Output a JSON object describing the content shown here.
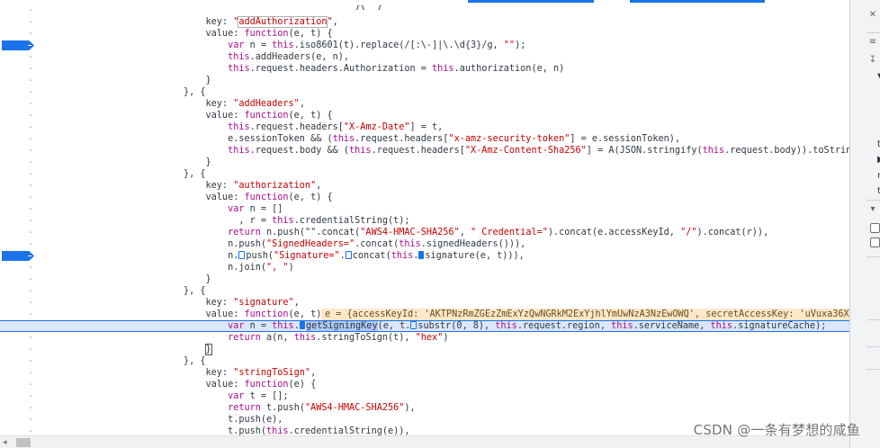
{
  "editor": {
    "lines": [
      {
        "indent": 0,
        "gutter": "-",
        "breakpoint": false,
        "paused": false,
        "parts": [
          {
            "t": "                                {}, {"
          }
        ],
        "hidden_prefix": true
      },
      {
        "indent": 0,
        "gutter": "-",
        "breakpoint": false,
        "paused": false,
        "parts": [
          {
            "t": "    key: ",
            "c": "tk"
          },
          {
            "t": "\"",
            "c": "str"
          },
          {
            "t": "addAuthorization",
            "c": "str boxed"
          },
          {
            "t": "\"",
            "c": "str"
          },
          {
            "t": ","
          }
        ]
      },
      {
        "indent": 0,
        "gutter": "-",
        "breakpoint": false,
        "paused": false,
        "parts": [
          {
            "t": "    value: "
          },
          {
            "t": "function",
            "c": "kw"
          },
          {
            "t": "(e, t) {"
          }
        ]
      },
      {
        "indent": 0,
        "gutter": "-",
        "breakpoint": true,
        "paused": false,
        "parts": [
          {
            "t": "        "
          },
          {
            "t": "var",
            "c": "kw"
          },
          {
            "t": " n = "
          },
          {
            "t": "this",
            "c": "kw"
          },
          {
            "t": ".iso8601(t).replace(/[:\\-]|\\.\\d{3}/g, "
          },
          {
            "t": "\"\"",
            "c": "str"
          },
          {
            "t": ");"
          }
        ]
      },
      {
        "indent": 0,
        "gutter": "-",
        "breakpoint": false,
        "paused": false,
        "parts": [
          {
            "t": "        "
          },
          {
            "t": "this",
            "c": "kw"
          },
          {
            "t": ".addHeaders(e, n),"
          }
        ]
      },
      {
        "indent": 0,
        "gutter": "-",
        "breakpoint": false,
        "paused": false,
        "parts": [
          {
            "t": "        "
          },
          {
            "t": "this",
            "c": "kw"
          },
          {
            "t": ".request.headers.Authorization = "
          },
          {
            "t": "this",
            "c": "kw"
          },
          {
            "t": ".authorization(e, n)"
          }
        ]
      },
      {
        "indent": 0,
        "gutter": "-",
        "breakpoint": false,
        "paused": false,
        "parts": [
          {
            "t": "    }"
          }
        ]
      },
      {
        "indent": 0,
        "gutter": "-",
        "breakpoint": false,
        "paused": false,
        "parts": [
          {
            "t": "}, {"
          }
        ]
      },
      {
        "indent": 0,
        "gutter": "-",
        "breakpoint": false,
        "paused": false,
        "parts": [
          {
            "t": "    key: "
          },
          {
            "t": "\"addHeaders\"",
            "c": "str"
          },
          {
            "t": ","
          }
        ]
      },
      {
        "indent": 0,
        "gutter": "-",
        "breakpoint": false,
        "paused": false,
        "parts": [
          {
            "t": "    value: "
          },
          {
            "t": "function",
            "c": "kw"
          },
          {
            "t": "(e, t) {"
          }
        ]
      },
      {
        "indent": 0,
        "gutter": "-",
        "breakpoint": false,
        "paused": false,
        "parts": [
          {
            "t": "        "
          },
          {
            "t": "this",
            "c": "kw"
          },
          {
            "t": ".request.headers["
          },
          {
            "t": "\"X-Amz-Date\"",
            "c": "str"
          },
          {
            "t": "] = t,"
          }
        ]
      },
      {
        "indent": 0,
        "gutter": "-",
        "breakpoint": false,
        "paused": false,
        "parts": [
          {
            "t": "        e.sessionToken && ("
          },
          {
            "t": "this",
            "c": "kw"
          },
          {
            "t": ".request.headers["
          },
          {
            "t": "\"x-amz-security-token\"",
            "c": "str"
          },
          {
            "t": "] = e.sessionToken),"
          }
        ]
      },
      {
        "indent": 0,
        "gutter": "-",
        "breakpoint": false,
        "paused": false,
        "parts": [
          {
            "t": "        "
          },
          {
            "t": "this",
            "c": "kw"
          },
          {
            "t": ".request.body && ("
          },
          {
            "t": "this",
            "c": "kw"
          },
          {
            "t": ".request.headers["
          },
          {
            "t": "\"X-Amz-Content-Sha256\"",
            "c": "str"
          },
          {
            "t": "] = A(JSON.stringify("
          },
          {
            "t": "this",
            "c": "kw"
          },
          {
            "t": ".request.body)).toString())"
          }
        ]
      },
      {
        "indent": 0,
        "gutter": "-",
        "breakpoint": false,
        "paused": false,
        "parts": [
          {
            "t": "    }"
          }
        ]
      },
      {
        "indent": 0,
        "gutter": "-",
        "breakpoint": false,
        "paused": false,
        "parts": [
          {
            "t": "}, {"
          }
        ]
      },
      {
        "indent": 0,
        "gutter": "-",
        "breakpoint": false,
        "paused": false,
        "parts": [
          {
            "t": "    key: "
          },
          {
            "t": "\"authorization\"",
            "c": "str"
          },
          {
            "t": ","
          }
        ]
      },
      {
        "indent": 0,
        "gutter": "-",
        "breakpoint": false,
        "paused": false,
        "parts": [
          {
            "t": "    value: "
          },
          {
            "t": "function",
            "c": "kw"
          },
          {
            "t": "(e, t) {"
          }
        ]
      },
      {
        "indent": 0,
        "gutter": "-",
        "breakpoint": false,
        "paused": false,
        "parts": [
          {
            "t": "        "
          },
          {
            "t": "var",
            "c": "kw"
          },
          {
            "t": " n = []"
          }
        ]
      },
      {
        "indent": 0,
        "gutter": "-",
        "breakpoint": false,
        "paused": false,
        "parts": [
          {
            "t": "          , r = "
          },
          {
            "t": "this",
            "c": "kw"
          },
          {
            "t": ".credentialString(t);"
          }
        ]
      },
      {
        "indent": 0,
        "gutter": "-",
        "breakpoint": false,
        "paused": false,
        "parts": [
          {
            "t": "        "
          },
          {
            "t": "return",
            "c": "kw"
          },
          {
            "t": " n.push(\"\".concat("
          },
          {
            "t": "\"AWS4-HMAC-SHA256\"",
            "c": "str"
          },
          {
            "t": ", "
          },
          {
            "t": "\" Credential=\"",
            "c": "str"
          },
          {
            "t": ").concat(e.accessKeyId, "
          },
          {
            "t": "\"/\"",
            "c": "str"
          },
          {
            "t": ").concat(r)),"
          }
        ]
      },
      {
        "indent": 0,
        "gutter": "-",
        "breakpoint": false,
        "paused": false,
        "parts": [
          {
            "t": "        n.push("
          },
          {
            "t": "\"SignedHeaders=\"",
            "c": "str"
          },
          {
            "t": ".concat("
          },
          {
            "t": "this",
            "c": "kw"
          },
          {
            "t": ".signedHeaders())),"
          }
        ]
      },
      {
        "indent": 0,
        "gutter": "-",
        "breakpoint": true,
        "paused": false,
        "parts": [
          {
            "t": "        n."
          },
          {
            "t": "",
            "c": "step outline"
          },
          {
            "t": "push("
          },
          {
            "t": "\"Signature=\"",
            "c": "str"
          },
          {
            "t": "."
          },
          {
            "t": "",
            "c": "step outline"
          },
          {
            "t": "concat("
          },
          {
            "t": "this",
            "c": "kw"
          },
          {
            "t": "."
          },
          {
            "t": "",
            "c": "step"
          },
          {
            "t": "signature(e, t))),"
          }
        ]
      },
      {
        "indent": 0,
        "gutter": "-",
        "breakpoint": false,
        "paused": false,
        "parts": [
          {
            "t": "        n.join("
          },
          {
            "t": "\", \"",
            "c": "str"
          },
          {
            "t": ")"
          }
        ]
      },
      {
        "indent": 0,
        "gutter": "-",
        "breakpoint": false,
        "paused": false,
        "parts": [
          {
            "t": "    }"
          }
        ]
      },
      {
        "indent": 0,
        "gutter": "-",
        "breakpoint": false,
        "paused": false,
        "parts": [
          {
            "t": "}, {"
          }
        ]
      },
      {
        "indent": 0,
        "gutter": "-",
        "breakpoint": false,
        "paused": false,
        "parts": [
          {
            "t": "    key: "
          },
          {
            "t": "\"signature\"",
            "c": "str"
          },
          {
            "t": ","
          }
        ]
      },
      {
        "indent": 0,
        "gutter": "-",
        "breakpoint": false,
        "paused": false,
        "parts": [
          {
            "t": "    value: "
          },
          {
            "t": "function",
            "c": "kw"
          },
          {
            "t": "(e, t) {"
          }
        ],
        "inline_value": "e = {accessKeyId: 'AKTPNzRmZGEzZmExYzQwNGRkM2ExYjhlYmUwNzA3NzEwOWQ', secretAccessKey: 'uVuxa36Xe"
      },
      {
        "indent": 0,
        "gutter": "-",
        "breakpoint": true,
        "paused": true,
        "parts": [
          {
            "t": "        "
          },
          {
            "t": "var",
            "c": "kw"
          },
          {
            "t": " n = "
          },
          {
            "t": "this",
            "c": "kw"
          },
          {
            "t": "."
          },
          {
            "t": "",
            "c": "step"
          },
          {
            "t": "getSigningKey",
            "c": "hl"
          },
          {
            "t": "(e, t."
          },
          {
            "t": "",
            "c": "step outline"
          },
          {
            "t": "substr(0, 8), "
          },
          {
            "t": "this",
            "c": "kw"
          },
          {
            "t": ".request.region, "
          },
          {
            "t": "this",
            "c": "kw"
          },
          {
            "t": ".serviceName, "
          },
          {
            "t": "this",
            "c": "kw"
          },
          {
            "t": ".signatureCache);"
          }
        ]
      },
      {
        "indent": 0,
        "gutter": "-",
        "breakpoint": false,
        "paused": false,
        "parts": [
          {
            "t": "        "
          },
          {
            "t": "return",
            "c": "kw"
          },
          {
            "t": " a(n, "
          },
          {
            "t": "this",
            "c": "kw"
          },
          {
            "t": ".stringToSign(t), "
          },
          {
            "t": "\"hex\"",
            "c": "str"
          },
          {
            "t": ")"
          }
        ]
      },
      {
        "indent": 0,
        "gutter": "-",
        "breakpoint": false,
        "paused": false,
        "parts": [
          {
            "t": "    "
          },
          {
            "t": "}",
            "c": "cursor-box"
          }
        ]
      },
      {
        "indent": 0,
        "gutter": "-",
        "breakpoint": false,
        "paused": false,
        "parts": [
          {
            "t": "}, {"
          }
        ]
      },
      {
        "indent": 0,
        "gutter": "-",
        "breakpoint": false,
        "paused": false,
        "parts": [
          {
            "t": "    key: "
          },
          {
            "t": "\"stringToSign\"",
            "c": "str"
          },
          {
            "t": ","
          }
        ]
      },
      {
        "indent": 0,
        "gutter": "-",
        "breakpoint": false,
        "paused": false,
        "parts": [
          {
            "t": "    value: "
          },
          {
            "t": "function",
            "c": "kw"
          },
          {
            "t": "(e) {"
          }
        ]
      },
      {
        "indent": 0,
        "gutter": "-",
        "breakpoint": false,
        "paused": false,
        "parts": [
          {
            "t": "        "
          },
          {
            "t": "var",
            "c": "kw"
          },
          {
            "t": " t = [];"
          }
        ]
      },
      {
        "indent": 0,
        "gutter": "-",
        "breakpoint": false,
        "paused": false,
        "parts": [
          {
            "t": "        "
          },
          {
            "t": "return",
            "c": "kw"
          },
          {
            "t": " t.push("
          },
          {
            "t": "\"AWS4-HMAC-SHA256\"",
            "c": "str"
          },
          {
            "t": "),"
          }
        ]
      },
      {
        "indent": 0,
        "gutter": "-",
        "breakpoint": false,
        "paused": false,
        "parts": [
          {
            "t": "        t.push(e),"
          }
        ]
      },
      {
        "indent": 0,
        "gutter": "-",
        "breakpoint": false,
        "paused": false,
        "parts": [
          {
            "t": "        t.push("
          },
          {
            "t": "this",
            "c": "kw"
          },
          {
            "t": ".credentialString(e)),"
          }
        ]
      }
    ]
  },
  "right_panel": {
    "letters": [
      "▼",
      "t",
      "▶",
      "r",
      "t"
    ],
    "buttons": [
      "‹",
      "›"
    ]
  },
  "watermark": "CSDN @一条有梦想的咸鱼",
  "colors": {
    "keyword": "#aa0d91",
    "string": "#c80000",
    "breakpoint": "#1a73e8",
    "paused_line": "#dbe7fb",
    "inline_value_bg": "#ffe7c9"
  }
}
